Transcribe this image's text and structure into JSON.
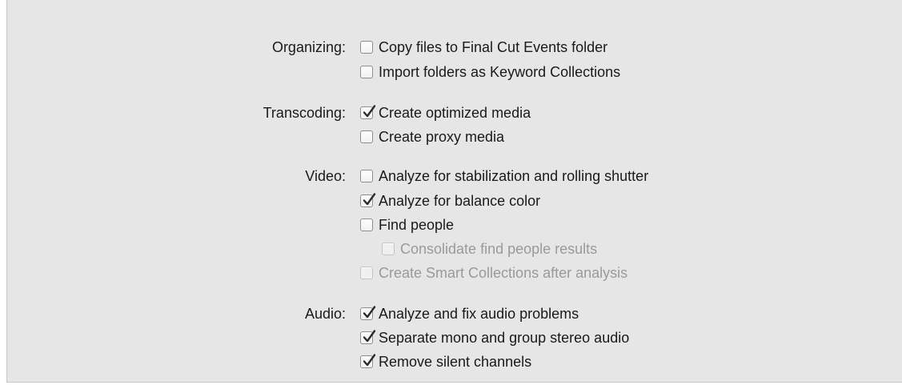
{
  "sections": [
    {
      "label": "Organizing:",
      "options": [
        {
          "text": "Copy files to Final Cut Events folder",
          "checked": false,
          "enabled": true
        },
        {
          "text": "Import folders as Keyword Collections",
          "checked": false,
          "enabled": true
        }
      ]
    },
    {
      "label": "Transcoding:",
      "options": [
        {
          "text": "Create optimized media",
          "checked": true,
          "enabled": true
        },
        {
          "text": "Create proxy media",
          "checked": false,
          "enabled": true
        }
      ]
    },
    {
      "label": "Video:",
      "options": [
        {
          "text": "Analyze for stabilization and rolling shutter",
          "checked": false,
          "enabled": true
        },
        {
          "text": "Analyze for balance color",
          "checked": true,
          "enabled": true
        },
        {
          "text": "Find people",
          "checked": false,
          "enabled": true
        },
        {
          "text": "Consolidate find people results",
          "checked": false,
          "enabled": false
        },
        {
          "text": "Create Smart Collections after analysis",
          "checked": false,
          "enabled": false
        }
      ]
    },
    {
      "label": "Audio:",
      "options": [
        {
          "text": "Analyze and fix audio problems",
          "checked": true,
          "enabled": true
        },
        {
          "text": "Separate mono and group stereo audio",
          "checked": true,
          "enabled": true
        },
        {
          "text": "Remove silent channels",
          "checked": true,
          "enabled": true
        }
      ]
    }
  ]
}
